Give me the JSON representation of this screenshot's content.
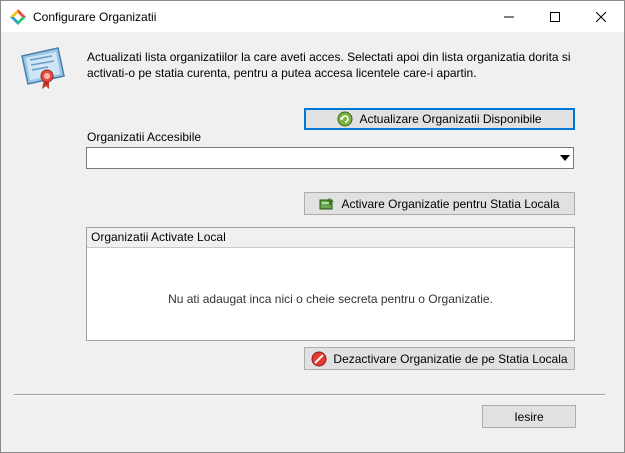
{
  "window": {
    "title": "Configurare Organizatii",
    "app_icon": "colorful-diamond-icon",
    "controls": {
      "minimize_icon": "minimize-icon",
      "maximize_icon": "maximize-icon",
      "close_icon": "close-icon"
    }
  },
  "intro": {
    "icon": "certificate-icon",
    "text": "Actualizati lista organizatiilor la care aveti acces. Selectati apoi din lista organizatia dorita si activati-o pe statia curenta, pentru a putea accesa licentele care-i apartin."
  },
  "refresh_button": {
    "label": "Actualizare Organizatii Disponibile",
    "icon": "refresh-icon"
  },
  "accessible": {
    "label": "Organizatii Accesibile",
    "selected": ""
  },
  "activate_button": {
    "label": "Activare Organizatie pentru Statia Locala",
    "icon": "activate-icon"
  },
  "activated_panel": {
    "header": "Organizatii Activate Local",
    "empty_message": "Nu ati adaugat inca nici o cheie secreta pentru o Organizatie."
  },
  "deactivate_button": {
    "label": "Dezactivare Organizatie de pe Statia Locala",
    "icon": "deactivate-icon"
  },
  "exit_button": {
    "label": "Iesire"
  },
  "colors": {
    "accent": "#0078d7",
    "background": "#f0f0f0",
    "button": "#e1e1e1"
  }
}
